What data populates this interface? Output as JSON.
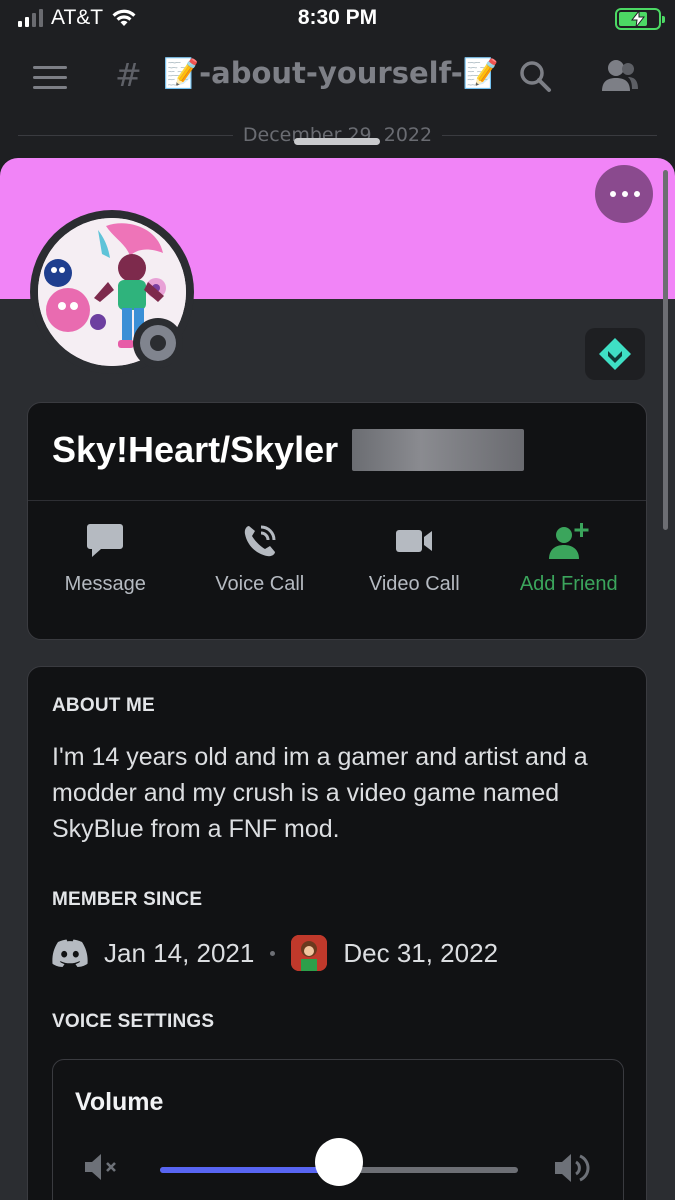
{
  "status_bar": {
    "carrier": "AT&T",
    "time": "8:30 PM",
    "battery_state": "charging"
  },
  "channel": {
    "name": "📝-about-yourself-📝",
    "date_divider": "December 29, 2022"
  },
  "profile": {
    "banner_color": "#f184f7",
    "display_name": "Sky!Heart/Skyler",
    "status": "offline",
    "actions": [
      {
        "label": "Message",
        "icon": "message-icon"
      },
      {
        "label": "Voice Call",
        "icon": "phone-icon"
      },
      {
        "label": "Video Call",
        "icon": "video-camera-icon"
      },
      {
        "label": "Add Friend",
        "icon": "add-friend-icon"
      }
    ],
    "about_me": {
      "title": "ABOUT ME",
      "text": "I'm 14 years old and im a gamer and artist and a modder and my crush is a video game named SkyBlue from a FNF mod."
    },
    "member_since": {
      "title": "MEMBER SINCE",
      "discord_date": "Jan 14, 2021",
      "server_date": "Dec 31, 2022"
    },
    "voice_settings": {
      "title": "VOICE SETTINGS",
      "volume_label": "Volume",
      "volume_level": 0.5
    }
  },
  "colors": {
    "accent": "#5865f2",
    "add_friend_green": "#3ba55c",
    "nitro_teal": "#3fe0c5"
  }
}
